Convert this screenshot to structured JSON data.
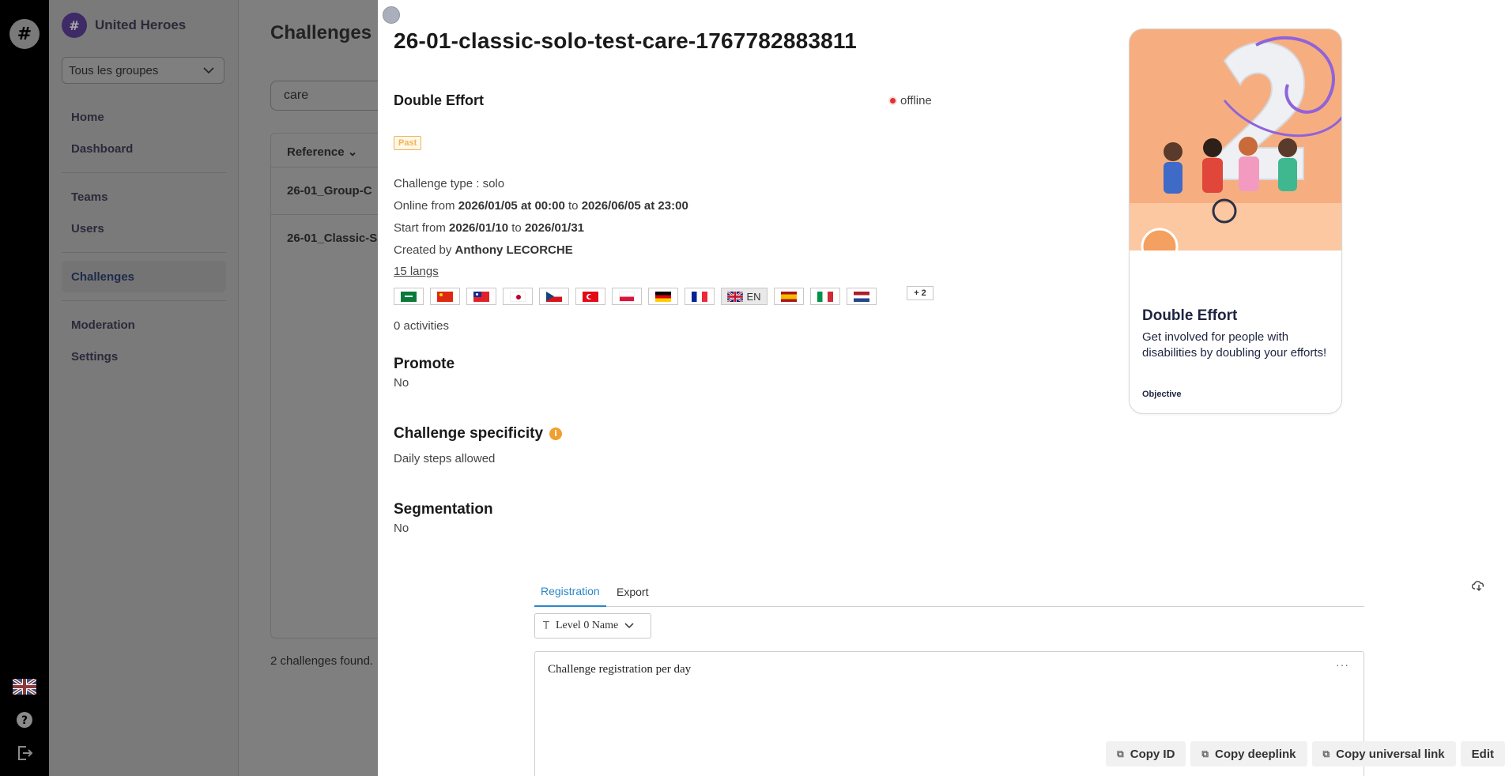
{
  "rail": {
    "logo_glyph": "#",
    "bottom_icons": [
      "uk-flag-icon",
      "help-icon",
      "logout-icon"
    ]
  },
  "sidebar": {
    "brand": "United Heroes",
    "brand_glyph": "#",
    "group_select": "Tous les groupes",
    "items": [
      {
        "label": "Home"
      },
      {
        "label": "Dashboard"
      },
      {
        "label": "Teams"
      },
      {
        "label": "Users"
      },
      {
        "label": "Challenges"
      },
      {
        "label": "Moderation"
      },
      {
        "label": "Settings"
      }
    ]
  },
  "main": {
    "title": "Challenges",
    "search_value": "care",
    "table_header": "Reference",
    "rows": [
      "26-01_Group-C",
      "26-01_Classic-S"
    ],
    "found": "2 challenges found."
  },
  "drawer": {
    "title": "26-01-classic-solo-test-care-1767782883811",
    "subtitle": "Double Effort",
    "status": "offline",
    "badge": "Past",
    "challenge_type_label": "Challenge type : ",
    "challenge_type": "solo",
    "online_label": "Online from ",
    "online_from": "2026/01/05 at 00:00",
    "to_word": " to ",
    "online_to": "2026/06/05 at 23:00",
    "start_label": "Start from ",
    "start_from": "2026/01/10",
    "start_to": "2026/01/31",
    "created_label": "Created by ",
    "created_by": "Anthony LECORCHE",
    "langs_link": "15 langs",
    "flags": [
      "sa",
      "cn",
      "tw",
      "jp",
      "cz",
      "tr",
      "pl",
      "de",
      "fr",
      "gb",
      "es",
      "it",
      "nl"
    ],
    "selected_lang": "EN",
    "more_langs": "+ 2",
    "activities": "0 activities",
    "promote_h": "Promote",
    "promote_v": "No",
    "specificity_h": "Challenge specificity",
    "specificity_v": "Daily steps allowed",
    "segmentation_h": "Segmentation",
    "segmentation_v": "No"
  },
  "preview": {
    "title": "Double Effort",
    "description": "Get involved for people with disabilities by doubling your efforts!",
    "objective": "Objective"
  },
  "tabs": {
    "registration": "Registration",
    "export": "Export"
  },
  "level_select": "Level 0 Name",
  "chart_card": {
    "title": "Challenge registration per day",
    "menu": "···"
  },
  "actions": {
    "copy_id": "Copy ID",
    "copy_deeplink": "Copy deeplink",
    "copy_universal": "Copy universal link",
    "edit": "Edit"
  },
  "colors": {
    "accent": "#2c86c8",
    "status_offline": "#e03232",
    "badge_past": "#f0b455",
    "info": "#f0a030"
  }
}
